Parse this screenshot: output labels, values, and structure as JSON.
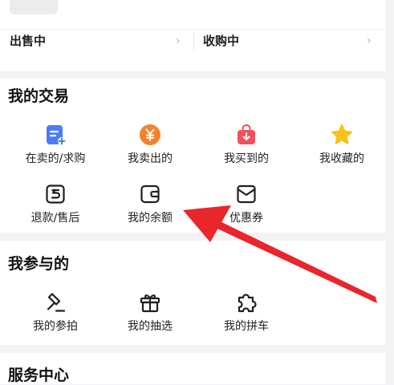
{
  "status": {
    "selling_label": "出售中",
    "buying_label": "收购中",
    "chevron": "›"
  },
  "trade": {
    "title": "我的交易",
    "items": [
      {
        "label": "在卖的/求购",
        "icon": "sell-list-icon",
        "color": "#4a7cf7"
      },
      {
        "label": "我卖出的",
        "icon": "yen-icon",
        "color": "#f5822a"
      },
      {
        "label": "我买到的",
        "icon": "bag-download-icon",
        "color": "#f2505a"
      },
      {
        "label": "我收藏的",
        "icon": "star-icon",
        "color": "#f7c21b"
      },
      {
        "label": "退款/售后",
        "icon": "refund-icon",
        "color": "#1f1f1f"
      },
      {
        "label": "我的余额",
        "icon": "wallet-icon",
        "color": "#1f1f1f"
      },
      {
        "label": "优惠券",
        "icon": "coupon-icon",
        "color": "#1f1f1f"
      }
    ]
  },
  "join": {
    "title": "我参与的",
    "items": [
      {
        "label": "我的参拍",
        "icon": "auction-hammer-icon"
      },
      {
        "label": "我的抽选",
        "icon": "gift-icon"
      },
      {
        "label": "我的拼车",
        "icon": "puzzle-icon"
      }
    ]
  },
  "service": {
    "title": "服务中心"
  },
  "annotation": {
    "color": "#e8262c"
  }
}
